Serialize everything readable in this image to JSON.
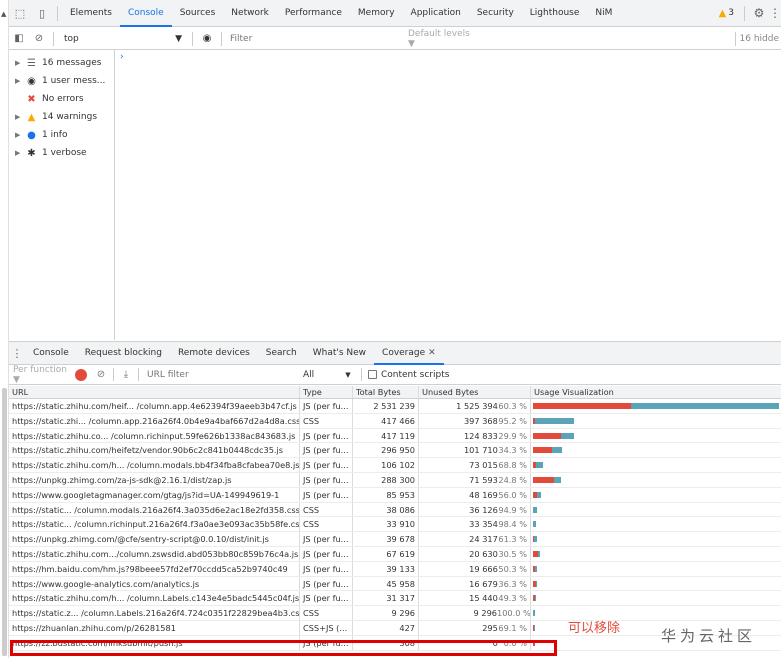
{
  "devtools_tabs": [
    {
      "label": "Elements",
      "active": false
    },
    {
      "label": "Console",
      "active": true
    },
    {
      "label": "Sources",
      "active": false
    },
    {
      "label": "Network",
      "active": false
    },
    {
      "label": "Performance",
      "active": false
    },
    {
      "label": "Memory",
      "active": false
    },
    {
      "label": "Application",
      "active": false
    },
    {
      "label": "Security",
      "active": false
    },
    {
      "label": "Lighthouse",
      "active": false
    },
    {
      "label": "NiM",
      "active": false
    }
  ],
  "issues_count": "3",
  "console_toolbar": {
    "context": "top",
    "filter_placeholder": "Filter",
    "levels": "Default levels ▼",
    "hidden_count": "16 hidde"
  },
  "console_sidebar": [
    {
      "label": "16 messages",
      "icon": "list-icon",
      "expandable": true,
      "selected": true
    },
    {
      "label": "1 user mess...",
      "icon": "user-icon",
      "expandable": true,
      "selected": false
    },
    {
      "label": "No errors",
      "icon": "error-icon",
      "expandable": false,
      "selected": false
    },
    {
      "label": "14 warnings",
      "icon": "warning-icon",
      "expandable": true,
      "selected": false
    },
    {
      "label": "1 info",
      "icon": "info-icon",
      "expandable": true,
      "selected": false
    },
    {
      "label": "1 verbose",
      "icon": "bug-icon",
      "expandable": true,
      "selected": false
    }
  ],
  "drawer_tabs": [
    {
      "label": "Console",
      "active": false
    },
    {
      "label": "Request blocking",
      "active": false
    },
    {
      "label": "Remote devices",
      "active": false
    },
    {
      "label": "Search",
      "active": false
    },
    {
      "label": "What's New",
      "active": false
    },
    {
      "label": "Coverage",
      "active": true,
      "closable": true
    }
  ],
  "coverage_toolbar": {
    "per_function": "Per function ▼",
    "url_filter_placeholder": "URL filter",
    "type_filter": "All",
    "content_scripts_label": "Content scripts"
  },
  "coverage_table": {
    "columns": [
      "URL",
      "Type",
      "Total Bytes",
      "Unused Bytes",
      "Usage Visualization"
    ],
    "max_total_bytes": 2531239,
    "rows": [
      {
        "url": "https://static.zhihu.com/heif... /column.app.4e62394f39aeeb3b47cf.js",
        "type": "JS (per fu...",
        "total": "2 531 239",
        "total_num": 2531239,
        "unused": "1 525 394",
        "unused_num": 1525394,
        "pct": "60.3 %"
      },
      {
        "url": "https://static.zhi... /column.app.216a26f4.0b4e9a4baf667d2a4d8a.css",
        "type": "CSS",
        "total": "417 466",
        "total_num": 417466,
        "unused": "397 368",
        "unused_num": 397368,
        "pct": "95.2 %"
      },
      {
        "url": "https://static.zhihu.co... /column.richinput.59fe626b1338ac843683.js",
        "type": "JS (per fu...",
        "total": "417 119",
        "total_num": 417119,
        "unused": "124 833",
        "unused_num": 124833,
        "pct": "29.9 %"
      },
      {
        "url": "https://static.zhihu.com/heifetz/vendor.90b6c2c841b0448cdc35.js",
        "type": "JS (per fu...",
        "total": "296 950",
        "total_num": 296950,
        "unused": "101 710",
        "unused_num": 101710,
        "pct": "34.3 %"
      },
      {
        "url": "https://static.zhihu.com/h... /column.modals.bb4f34fba8cfabea70e8.js",
        "type": "JS (per fu...",
        "total": "106 102",
        "total_num": 106102,
        "unused": "73 015",
        "unused_num": 73015,
        "pct": "68.8 %"
      },
      {
        "url": "https://unpkg.zhimg.com/za-js-sdk@2.16.1/dist/zap.js",
        "type": "JS (per fu...",
        "total": "288 300",
        "total_num": 288300,
        "unused": "71 593",
        "unused_num": 71593,
        "pct": "24.8 %"
      },
      {
        "url": "https://www.googletagmanager.com/gtag/js?id=UA-149949619-1",
        "type": "JS (per fu...",
        "total": "85 953",
        "total_num": 85953,
        "unused": "48 169",
        "unused_num": 48169,
        "pct": "56.0 %"
      },
      {
        "url": "https://static... /column.modals.216a26f4.3a035d6e2ac18e2fd358.css",
        "type": "CSS",
        "total": "38 086",
        "total_num": 38086,
        "unused": "36 126",
        "unused_num": 36126,
        "pct": "94.9 %"
      },
      {
        "url": "https://static... /column.richinput.216a26f4.f3a0ae3e093ac35b58fe.css",
        "type": "CSS",
        "total": "33 910",
        "total_num": 33910,
        "unused": "33 354",
        "unused_num": 33354,
        "pct": "98.4 %"
      },
      {
        "url": "https://unpkg.zhimg.com/@cfe/sentry-script@0.0.10/dist/init.js",
        "type": "JS (per fu...",
        "total": "39 678",
        "total_num": 39678,
        "unused": "24 317",
        "unused_num": 24317,
        "pct": "61.3 %"
      },
      {
        "url": "https://static.zhihu.com.../column.zswsdid.abd053bb80c859b76c4a.js",
        "type": "JS (per fu...",
        "total": "67 619",
        "total_num": 67619,
        "unused": "20 630",
        "unused_num": 20630,
        "pct": "30.5 %"
      },
      {
        "url": "https://hm.baidu.com/hm.js?98beee57fd2ef70ccdd5ca52b9740c49",
        "type": "JS (per fu...",
        "total": "39 133",
        "total_num": 39133,
        "unused": "19 666",
        "unused_num": 19666,
        "pct": "50.3 %"
      },
      {
        "url": "https://www.google-analytics.com/analytics.js",
        "type": "JS (per fu...",
        "total": "45 958",
        "total_num": 45958,
        "unused": "16 679",
        "unused_num": 16679,
        "pct": "36.3 %"
      },
      {
        "url": "https://static.zhihu.com/h... /column.Labels.c143e4e5badc5445c04f.js",
        "type": "JS (per fu...",
        "total": "31 317",
        "total_num": 31317,
        "unused": "15 440",
        "unused_num": 15440,
        "pct": "49.3 %"
      },
      {
        "url": "https://static.z... /column.Labels.216a26f4.724c0351f22829bea4b3.css",
        "type": "CSS",
        "total": "9 296",
        "total_num": 9296,
        "unused": "9 296",
        "unused_num": 9296,
        "pct": "100.0 %"
      },
      {
        "url": "https://zhuanlan.zhihu.com/p/26281581",
        "type": "CSS+JS (...",
        "total": "427",
        "total_num": 427,
        "unused": "295",
        "unused_num": 295,
        "pct": "69.1 %"
      },
      {
        "url": "https://zz.bdstatic.com/linksubmit/push.js",
        "type": "JS (per fu...",
        "total": "308",
        "total_num": 308,
        "unused": "0",
        "unused_num": 0,
        "pct": "0.0 %",
        "highlighted": true
      }
    ]
  },
  "annotation_note": "可以移除",
  "watermark": "华为云社区",
  "colors": {
    "accent": "#1a73e8",
    "used_bar": "#e24b3b",
    "unused_bar": "#5ba3b8",
    "highlight": "#e00000",
    "warning": "#f9ab00"
  }
}
